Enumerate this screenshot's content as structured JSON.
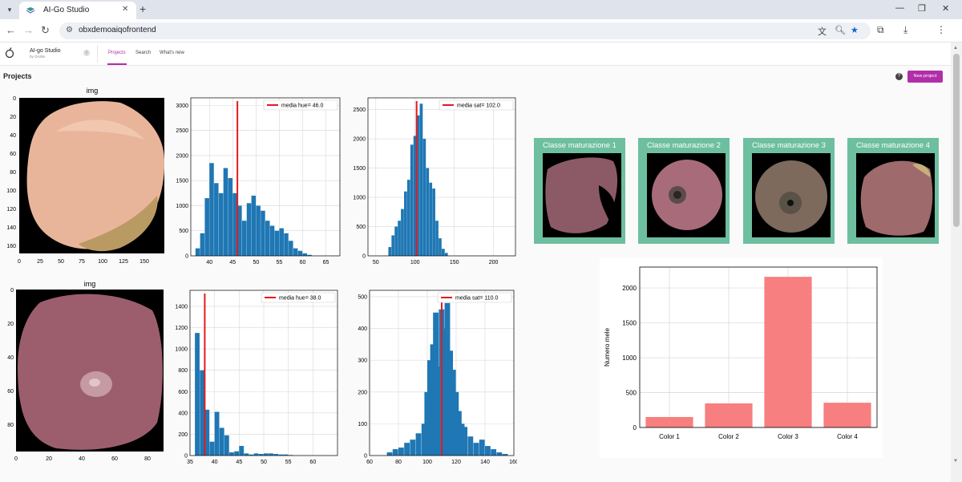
{
  "browser": {
    "tab_title": "AI-Go Studio",
    "url": "obxdemoaiqofrontend"
  },
  "app": {
    "name": "AI-go Studio",
    "subtitle": "by Orobix",
    "nav": [
      "Projects",
      "Search",
      "What's new"
    ],
    "active_nav": "Projects"
  },
  "page": {
    "title": "Projects",
    "new_project_label": "New project"
  },
  "colors": {
    "accent": "#b12ea8",
    "card_bg": "#6dbf9f",
    "hist_bar": "#1f77b4",
    "mean_line": "#e41a1c",
    "bar_fill": "#f77f7f"
  },
  "rows": [
    {
      "image": {
        "title": "img",
        "xticks": [
          "0",
          "25",
          "50",
          "75",
          "100",
          "125",
          "150"
        ],
        "yticks": [
          "0",
          "20",
          "40",
          "60",
          "80",
          "100",
          "120",
          "140",
          "160"
        ]
      },
      "hue": {
        "legend": "media hue= 46.0",
        "xticks": [
          "40",
          "45",
          "50",
          "55",
          "60",
          "65"
        ],
        "yticks": [
          "0",
          "500",
          "1000",
          "1500",
          "2000",
          "2500",
          "3000"
        ]
      },
      "sat": {
        "legend": "media sat= 102.0",
        "xticks": [
          "50",
          "100",
          "150",
          "200"
        ],
        "yticks": [
          "0",
          "500",
          "1000",
          "1500",
          "2000",
          "2500"
        ]
      }
    },
    {
      "image": {
        "title": "img",
        "xticks": [
          "0",
          "20",
          "40",
          "60",
          "80"
        ],
        "yticks": [
          "0",
          "20",
          "40",
          "60",
          "80"
        ]
      },
      "hue": {
        "legend": "media hue= 38.0",
        "xticks": [
          "35",
          "40",
          "45",
          "50",
          "55",
          "60"
        ],
        "yticks": [
          "0",
          "200",
          "400",
          "600",
          "800",
          "1000",
          "1200",
          "1400"
        ]
      },
      "sat": {
        "legend": "media sat= 110.0",
        "xticks": [
          "60",
          "80",
          "100",
          "120",
          "140",
          "160"
        ],
        "yticks": [
          "0",
          "100",
          "200",
          "300",
          "400",
          "500"
        ]
      }
    }
  ],
  "classes": [
    {
      "label": "Classe maturazione 1"
    },
    {
      "label": "Classe maturazione 2"
    },
    {
      "label": "Classe maturazione 3"
    },
    {
      "label": "Classe maturazione 4"
    }
  ],
  "chart_data": [
    {
      "type": "bar",
      "name": "hue-histogram-1",
      "x": [
        37,
        38,
        39,
        40,
        41,
        42,
        43,
        44,
        45,
        46,
        47,
        48,
        49,
        50,
        51,
        52,
        53,
        54,
        55,
        56,
        57,
        58,
        59,
        60,
        61
      ],
      "values": [
        150,
        450,
        1150,
        1850,
        1450,
        1250,
        1750,
        1550,
        1250,
        1000,
        700,
        1050,
        1200,
        1000,
        900,
        700,
        600,
        500,
        550,
        450,
        300,
        150,
        100,
        50,
        20
      ],
      "mean_label": "media hue= 46.0",
      "mean": 46.0,
      "xlim": [
        36,
        68
      ],
      "ylim": [
        0,
        3150
      ]
    },
    {
      "type": "bar",
      "name": "sat-histogram-1",
      "x": [
        66,
        70,
        74,
        78,
        82,
        86,
        90,
        94,
        98,
        102,
        106,
        110,
        114,
        118,
        122,
        126,
        130,
        134,
        138
      ],
      "values": [
        150,
        350,
        500,
        600,
        800,
        1100,
        1300,
        1900,
        2050,
        2400,
        2600,
        2000,
        1500,
        1250,
        1150,
        600,
        300,
        120,
        50
      ],
      "mean_label": "media sat= 102.0",
      "mean": 102.0,
      "xlim": [
        40,
        228
      ],
      "ylim": [
        0,
        2700
      ]
    },
    {
      "type": "bar",
      "name": "hue-histogram-2",
      "x": [
        36,
        37,
        38,
        39,
        40,
        41,
        42,
        43,
        44,
        45,
        46,
        47,
        48,
        49,
        50,
        51,
        52,
        53,
        54,
        55
      ],
      "values": [
        1150,
        800,
        430,
        130,
        410,
        260,
        190,
        30,
        40,
        90,
        20,
        10,
        20,
        15,
        20,
        20,
        15,
        10,
        10,
        5
      ],
      "mean_label": "media hue= 38.0",
      "mean": 38.0,
      "xlim": [
        35,
        65
      ],
      "ylim": [
        0,
        1550
      ]
    },
    {
      "type": "bar",
      "name": "sat-histogram-2",
      "x": [
        72,
        76,
        80,
        84,
        88,
        92,
        96,
        98,
        100,
        102,
        104,
        106,
        108,
        110,
        112,
        114,
        116,
        118,
        120,
        122,
        124,
        128,
        132,
        136,
        140,
        144,
        148,
        152
      ],
      "values": [
        10,
        20,
        25,
        40,
        50,
        70,
        100,
        200,
        300,
        350,
        450,
        280,
        460,
        400,
        480,
        330,
        270,
        200,
        140,
        100,
        90,
        60,
        40,
        50,
        30,
        20,
        10,
        5
      ],
      "mean_label": "media sat= 110.0",
      "mean": 110.0,
      "xlim": [
        60,
        160
      ],
      "ylim": [
        0,
        520
      ]
    },
    {
      "type": "bar",
      "name": "class-counts",
      "categories": [
        "Color 1",
        "Color 2",
        "Color 3",
        "Color 4"
      ],
      "values": [
        150,
        345,
        2160,
        355
      ],
      "ylabel": "Numero mele",
      "yticks": [
        0,
        500,
        1000,
        1500,
        2000
      ],
      "ylim": [
        0,
        2300
      ]
    }
  ]
}
